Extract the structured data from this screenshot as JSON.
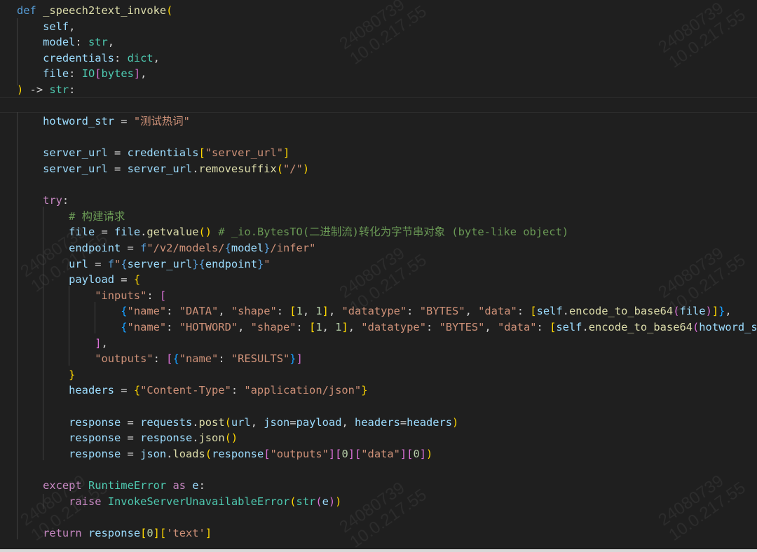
{
  "editor": {
    "language": "python",
    "watermark": "24080739\n10.0.217.55",
    "lines": [
      [
        [
          "kw",
          "def "
        ],
        [
          "fn",
          "_speech2text_invoke"
        ],
        [
          "b1",
          "("
        ]
      ],
      [
        [
          "op",
          "    "
        ],
        [
          "var",
          "self"
        ],
        [
          "op",
          ","
        ]
      ],
      [
        [
          "op",
          "    "
        ],
        [
          "var",
          "model"
        ],
        [
          "op",
          ": "
        ],
        [
          "typ",
          "str"
        ],
        [
          "op",
          ","
        ]
      ],
      [
        [
          "op",
          "    "
        ],
        [
          "var",
          "credentials"
        ],
        [
          "op",
          ": "
        ],
        [
          "typ",
          "dict"
        ],
        [
          "op",
          ","
        ]
      ],
      [
        [
          "op",
          "    "
        ],
        [
          "var",
          "file"
        ],
        [
          "op",
          ": "
        ],
        [
          "typ",
          "IO"
        ],
        [
          "b2",
          "["
        ],
        [
          "typ",
          "bytes"
        ],
        [
          "b2",
          "]"
        ],
        [
          "op",
          ","
        ]
      ],
      [
        [
          "b1",
          ")"
        ],
        [
          "op",
          " -> "
        ],
        [
          "typ",
          "str"
        ],
        [
          "op",
          ":"
        ]
      ],
      [],
      [
        [
          "op",
          "    "
        ],
        [
          "var",
          "hotword_str"
        ],
        [
          "op",
          " = "
        ],
        [
          "str",
          "\"测试热词\""
        ]
      ],
      [],
      [
        [
          "op",
          "    "
        ],
        [
          "var",
          "server_url"
        ],
        [
          "op",
          " = "
        ],
        [
          "var",
          "credentials"
        ],
        [
          "b1",
          "["
        ],
        [
          "str",
          "\"server_url\""
        ],
        [
          "b1",
          "]"
        ]
      ],
      [
        [
          "op",
          "    "
        ],
        [
          "var",
          "server_url"
        ],
        [
          "op",
          " = "
        ],
        [
          "var",
          "server_url"
        ],
        [
          "op",
          "."
        ],
        [
          "fn",
          "removesuffix"
        ],
        [
          "b1",
          "("
        ],
        [
          "str",
          "\"/\""
        ],
        [
          "b1",
          ")"
        ]
      ],
      [],
      [
        [
          "op",
          "    "
        ],
        [
          "ctl",
          "try"
        ],
        [
          "op",
          ":"
        ]
      ],
      [
        [
          "op",
          "        "
        ],
        [
          "cmt",
          "# 构建请求"
        ]
      ],
      [
        [
          "op",
          "        "
        ],
        [
          "var",
          "file"
        ],
        [
          "op",
          " = "
        ],
        [
          "var",
          "file"
        ],
        [
          "op",
          "."
        ],
        [
          "fn",
          "getvalue"
        ],
        [
          "b1",
          "()"
        ],
        [
          "op",
          " "
        ],
        [
          "cmt",
          "# _io.BytesTO(二进制流)转化为字节串对象 (byte-like object)"
        ]
      ],
      [
        [
          "op",
          "        "
        ],
        [
          "var",
          "endpoint"
        ],
        [
          "op",
          " = "
        ],
        [
          "kw",
          "f"
        ],
        [
          "str",
          "\"/v2/models/"
        ],
        [
          "kw",
          "{"
        ],
        [
          "var",
          "model"
        ],
        [
          "kw",
          "}"
        ],
        [
          "str",
          "/infer\""
        ]
      ],
      [
        [
          "op",
          "        "
        ],
        [
          "var",
          "url"
        ],
        [
          "op",
          " = "
        ],
        [
          "kw",
          "f"
        ],
        [
          "str",
          "\""
        ],
        [
          "kw",
          "{"
        ],
        [
          "var",
          "server_url"
        ],
        [
          "kw",
          "}{"
        ],
        [
          "var",
          "endpoint"
        ],
        [
          "kw",
          "}"
        ],
        [
          "str",
          "\""
        ]
      ],
      [
        [
          "op",
          "        "
        ],
        [
          "var",
          "payload"
        ],
        [
          "op",
          " = "
        ],
        [
          "b1",
          "{"
        ]
      ],
      [
        [
          "op",
          "            "
        ],
        [
          "str",
          "\"inputs\""
        ],
        [
          "op",
          ": "
        ],
        [
          "b2",
          "["
        ]
      ],
      [
        [
          "op",
          "                "
        ],
        [
          "b3",
          "{"
        ],
        [
          "str",
          "\"name\""
        ],
        [
          "op",
          ": "
        ],
        [
          "str",
          "\"DATA\""
        ],
        [
          "op",
          ", "
        ],
        [
          "str",
          "\"shape\""
        ],
        [
          "op",
          ": "
        ],
        [
          "b1",
          "["
        ],
        [
          "num",
          "1"
        ],
        [
          "op",
          ", "
        ],
        [
          "num",
          "1"
        ],
        [
          "b1",
          "]"
        ],
        [
          "op",
          ", "
        ],
        [
          "str",
          "\"datatype\""
        ],
        [
          "op",
          ": "
        ],
        [
          "str",
          "\"BYTES\""
        ],
        [
          "op",
          ", "
        ],
        [
          "str",
          "\"data\""
        ],
        [
          "op",
          ": "
        ],
        [
          "b1",
          "["
        ],
        [
          "var",
          "self"
        ],
        [
          "op",
          "."
        ],
        [
          "fn",
          "encode_to_base64"
        ],
        [
          "b2",
          "("
        ],
        [
          "var",
          "file"
        ],
        [
          "b2",
          ")"
        ],
        [
          "b1",
          "]"
        ],
        [
          "b3",
          "}"
        ],
        [
          "op",
          ","
        ]
      ],
      [
        [
          "op",
          "                "
        ],
        [
          "b3",
          "{"
        ],
        [
          "str",
          "\"name\""
        ],
        [
          "op",
          ": "
        ],
        [
          "str",
          "\"HOTWORD\""
        ],
        [
          "op",
          ", "
        ],
        [
          "str",
          "\"shape\""
        ],
        [
          "op",
          ": "
        ],
        [
          "b1",
          "["
        ],
        [
          "num",
          "1"
        ],
        [
          "op",
          ", "
        ],
        [
          "num",
          "1"
        ],
        [
          "b1",
          "]"
        ],
        [
          "op",
          ", "
        ],
        [
          "str",
          "\"datatype\""
        ],
        [
          "op",
          ": "
        ],
        [
          "str",
          "\"BYTES\""
        ],
        [
          "op",
          ", "
        ],
        [
          "str",
          "\"data\""
        ],
        [
          "op",
          ": "
        ],
        [
          "b1",
          "["
        ],
        [
          "var",
          "self"
        ],
        [
          "op",
          "."
        ],
        [
          "fn",
          "encode_to_base64"
        ],
        [
          "b2",
          "("
        ],
        [
          "var",
          "hotword_st"
        ]
      ],
      [
        [
          "op",
          "            "
        ],
        [
          "b2",
          "]"
        ],
        [
          "op",
          ","
        ]
      ],
      [
        [
          "op",
          "            "
        ],
        [
          "str",
          "\"outputs\""
        ],
        [
          "op",
          ": "
        ],
        [
          "b2",
          "["
        ],
        [
          "b3",
          "{"
        ],
        [
          "str",
          "\"name\""
        ],
        [
          "op",
          ": "
        ],
        [
          "str",
          "\"RESULTS\""
        ],
        [
          "b3",
          "}"
        ],
        [
          "b2",
          "]"
        ]
      ],
      [
        [
          "op",
          "        "
        ],
        [
          "b1",
          "}"
        ]
      ],
      [
        [
          "op",
          "        "
        ],
        [
          "var",
          "headers"
        ],
        [
          "op",
          " = "
        ],
        [
          "b1",
          "{"
        ],
        [
          "str",
          "\"Content-Type\""
        ],
        [
          "op",
          ": "
        ],
        [
          "str",
          "\"application/json\""
        ],
        [
          "b1",
          "}"
        ]
      ],
      [],
      [
        [
          "op",
          "        "
        ],
        [
          "var",
          "response"
        ],
        [
          "op",
          " = "
        ],
        [
          "var",
          "requests"
        ],
        [
          "op",
          "."
        ],
        [
          "fn",
          "post"
        ],
        [
          "b1",
          "("
        ],
        [
          "var",
          "url"
        ],
        [
          "op",
          ", "
        ],
        [
          "var",
          "json"
        ],
        [
          "op",
          "="
        ],
        [
          "var",
          "payload"
        ],
        [
          "op",
          ", "
        ],
        [
          "var",
          "headers"
        ],
        [
          "op",
          "="
        ],
        [
          "var",
          "headers"
        ],
        [
          "b1",
          ")"
        ]
      ],
      [
        [
          "op",
          "        "
        ],
        [
          "var",
          "response"
        ],
        [
          "op",
          " = "
        ],
        [
          "var",
          "response"
        ],
        [
          "op",
          "."
        ],
        [
          "fn",
          "json"
        ],
        [
          "b1",
          "()"
        ]
      ],
      [
        [
          "op",
          "        "
        ],
        [
          "var",
          "response"
        ],
        [
          "op",
          " = "
        ],
        [
          "var",
          "json"
        ],
        [
          "op",
          "."
        ],
        [
          "fn",
          "loads"
        ],
        [
          "b1",
          "("
        ],
        [
          "var",
          "response"
        ],
        [
          "b2",
          "["
        ],
        [
          "str",
          "\"outputs\""
        ],
        [
          "b2",
          "]["
        ],
        [
          "num",
          "0"
        ],
        [
          "b2",
          "]["
        ],
        [
          "str",
          "\"data\""
        ],
        [
          "b2",
          "]["
        ],
        [
          "num",
          "0"
        ],
        [
          "b2",
          "]"
        ],
        [
          "b1",
          ")"
        ]
      ],
      [],
      [
        [
          "op",
          "    "
        ],
        [
          "ctl",
          "except"
        ],
        [
          "op",
          " "
        ],
        [
          "typ",
          "RuntimeError"
        ],
        [
          "op",
          " "
        ],
        [
          "ctl",
          "as"
        ],
        [
          "op",
          " "
        ],
        [
          "var",
          "e"
        ],
        [
          "op",
          ":"
        ]
      ],
      [
        [
          "op",
          "        "
        ],
        [
          "ctl",
          "raise"
        ],
        [
          "op",
          " "
        ],
        [
          "typ",
          "InvokeServerUnavailableError"
        ],
        [
          "b1",
          "("
        ],
        [
          "typ",
          "str"
        ],
        [
          "b2",
          "("
        ],
        [
          "var",
          "e"
        ],
        [
          "b2",
          ")"
        ],
        [
          "b1",
          ")"
        ]
      ],
      [],
      [
        [
          "op",
          "    "
        ],
        [
          "ctl",
          "return"
        ],
        [
          "op",
          " "
        ],
        [
          "var",
          "response"
        ],
        [
          "b1",
          "["
        ],
        [
          "num",
          "0"
        ],
        [
          "b1",
          "]["
        ],
        [
          "str",
          "'text'"
        ],
        [
          "b1",
          "]"
        ]
      ]
    ]
  }
}
